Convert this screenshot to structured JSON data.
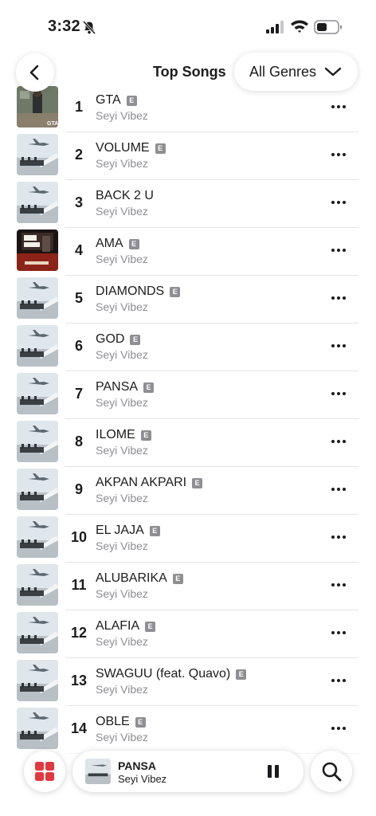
{
  "status_bar": {
    "time": "3:32"
  },
  "header": {
    "title": "Top Songs",
    "genre_label": "All Genres"
  },
  "songs": [
    {
      "rank": "1",
      "title": "GTA",
      "artist": "Seyi Vibez",
      "explicit": "E",
      "art": "gta"
    },
    {
      "rank": "2",
      "title": "VOLUME",
      "artist": "Seyi Vibez",
      "explicit": "E",
      "art": "plane"
    },
    {
      "rank": "3",
      "title": "BACK 2 U",
      "artist": "Seyi Vibez",
      "explicit": "",
      "art": "plane"
    },
    {
      "rank": "4",
      "title": "AMA",
      "artist": "Seyi Vibez",
      "explicit": "E",
      "art": "poster"
    },
    {
      "rank": "5",
      "title": "DIAMONDS",
      "artist": "Seyi Vibez",
      "explicit": "E",
      "art": "plane"
    },
    {
      "rank": "6",
      "title": "GOD",
      "artist": "Seyi Vibez",
      "explicit": "E",
      "art": "plane"
    },
    {
      "rank": "7",
      "title": "PANSA",
      "artist": "Seyi Vibez",
      "explicit": "E",
      "art": "plane"
    },
    {
      "rank": "8",
      "title": "ILOME",
      "artist": "Seyi Vibez",
      "explicit": "E",
      "art": "plane"
    },
    {
      "rank": "9",
      "title": "AKPAN AKPARI",
      "artist": "Seyi Vibez",
      "explicit": "E",
      "art": "plane"
    },
    {
      "rank": "10",
      "title": "EL JAJA",
      "artist": "Seyi Vibez",
      "explicit": "E",
      "art": "plane"
    },
    {
      "rank": "11",
      "title": "ALUBARIKA",
      "artist": "Seyi Vibez",
      "explicit": "E",
      "art": "plane"
    },
    {
      "rank": "12",
      "title": "ALAFIA",
      "artist": "Seyi Vibez",
      "explicit": "E",
      "art": "plane"
    },
    {
      "rank": "13",
      "title": "SWAGUU (feat. Quavo)",
      "artist": "Seyi Vibez",
      "explicit": "E",
      "art": "plane"
    },
    {
      "rank": "14",
      "title": "OBLE",
      "artist": "Seyi Vibez",
      "explicit": "E",
      "art": "plane"
    }
  ],
  "player": {
    "title": "PANSA",
    "artist": "Seyi Vibez"
  },
  "colors": {
    "accent_red": "#e2383f",
    "secondary_text": "#8e8e93",
    "badge": "#8e8e93"
  },
  "icons": {
    "back": "chevron-left-icon",
    "genre": "chevron-down-icon",
    "more": "ellipsis-icon",
    "library": "grid-icon",
    "pause": "pause-icon",
    "search": "search-icon"
  }
}
